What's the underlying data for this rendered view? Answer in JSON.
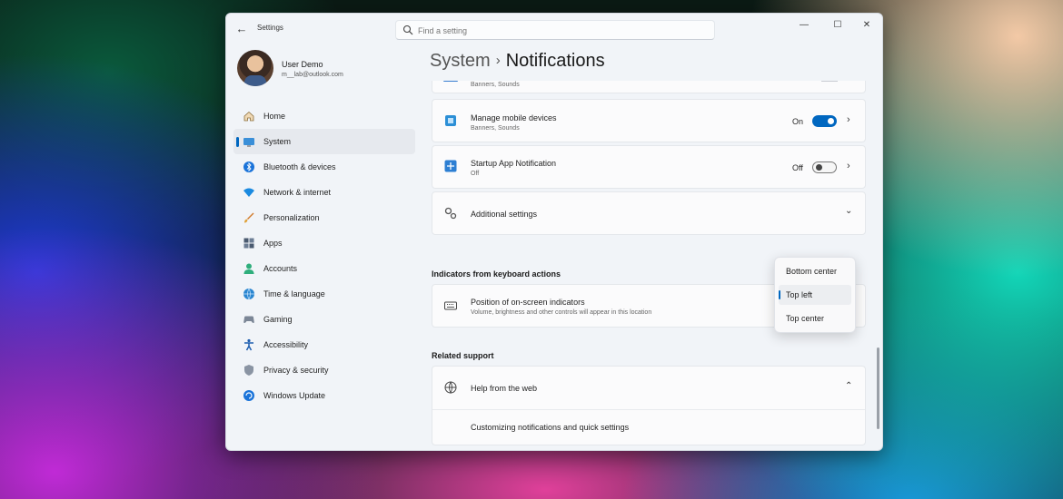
{
  "window": {
    "back_glyph": "←",
    "app_title": "Settings",
    "controls": {
      "minimize": "—",
      "maximize": "☐",
      "close": "✕"
    }
  },
  "search": {
    "placeholder": "Find a setting",
    "value": ""
  },
  "user": {
    "name": "User Demo",
    "email": "m__lab@outlook.com"
  },
  "sidebar": {
    "items": [
      {
        "label": "Home",
        "icon": "home-icon",
        "active": false
      },
      {
        "label": "System",
        "icon": "system-icon",
        "active": true
      },
      {
        "label": "Bluetooth & devices",
        "icon": "bluetooth-icon",
        "active": false
      },
      {
        "label": "Network & internet",
        "icon": "wifi-icon",
        "active": false
      },
      {
        "label": "Personalization",
        "icon": "brush-icon",
        "active": false
      },
      {
        "label": "Apps",
        "icon": "apps-icon",
        "active": false
      },
      {
        "label": "Accounts",
        "icon": "person-icon",
        "active": false
      },
      {
        "label": "Time & language",
        "icon": "globe-clock-icon",
        "active": false
      },
      {
        "label": "Gaming",
        "icon": "gamepad-icon",
        "active": false
      },
      {
        "label": "Accessibility",
        "icon": "accessibility-icon",
        "active": false
      },
      {
        "label": "Privacy & security",
        "icon": "shield-icon",
        "active": false
      },
      {
        "label": "Windows Update",
        "icon": "update-icon",
        "active": false
      }
    ]
  },
  "breadcrumb": {
    "parent": "System",
    "separator": "›",
    "current": "Notifications"
  },
  "settings": {
    "partial_sub": "Banners, Sounds",
    "mobile": {
      "title": "Manage mobile devices",
      "sub": "Banners, Sounds",
      "state": "On",
      "toggle_on": true
    },
    "startup": {
      "title": "Startup App Notification",
      "sub": "Off",
      "state": "Off",
      "toggle_on": false
    },
    "additional": {
      "title": "Additional settings"
    },
    "indicators_section": "Indicators from keyboard actions",
    "position": {
      "title": "Position of on-screen indicators",
      "sub": "Volume, brightness and other controls will appear in this location"
    },
    "related_section": "Related support",
    "help": {
      "title": "Help from the web",
      "link": "Customizing notifications and quick settings"
    }
  },
  "position_dropdown": {
    "options": [
      "Bottom center",
      "Top left",
      "Top center"
    ],
    "selected": "Top left"
  },
  "colors": {
    "accent": "#0067c0",
    "window_bg": "#f1f4f8",
    "card_bg": "#fbfbfc"
  }
}
